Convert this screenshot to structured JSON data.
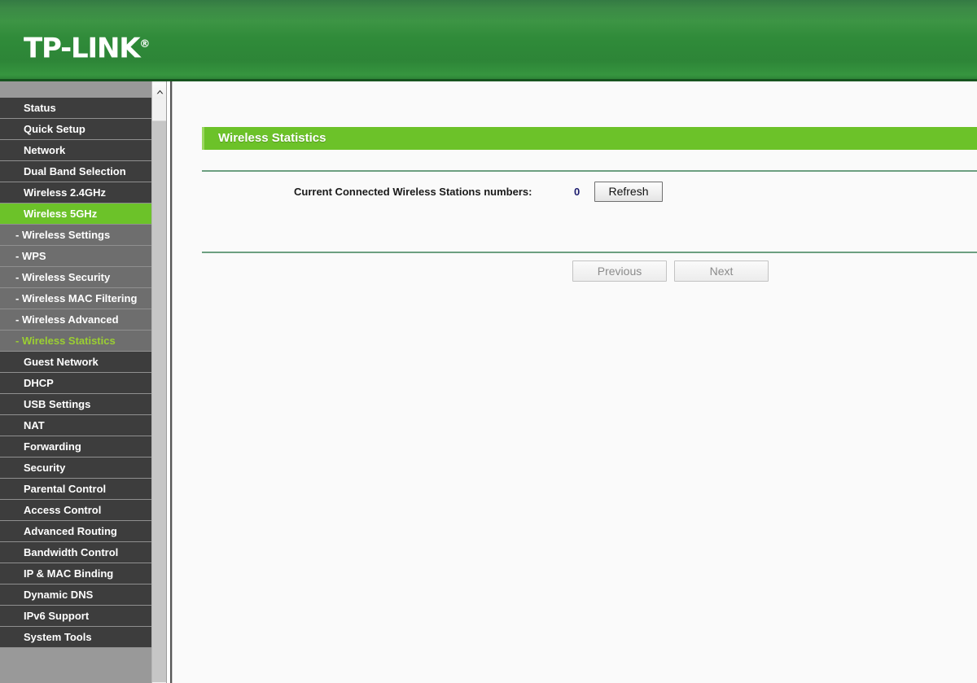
{
  "header": {
    "brand": "TP-LINK",
    "brand_mark": "®",
    "brand_color": "#2f8a39"
  },
  "sidebar": {
    "items": [
      {
        "label": "Status",
        "type": "top",
        "state": "normal"
      },
      {
        "label": "Quick Setup",
        "type": "top",
        "state": "normal"
      },
      {
        "label": "Network",
        "type": "top",
        "state": "normal"
      },
      {
        "label": "Dual Band Selection",
        "type": "top",
        "state": "normal"
      },
      {
        "label": "Wireless 2.4GHz",
        "type": "top",
        "state": "normal"
      },
      {
        "label": "Wireless 5GHz",
        "type": "top",
        "state": "active"
      },
      {
        "label": "- Wireless Settings",
        "type": "sub",
        "state": "normal"
      },
      {
        "label": "- WPS",
        "type": "sub",
        "state": "normal"
      },
      {
        "label": "- Wireless Security",
        "type": "sub",
        "state": "normal"
      },
      {
        "label": "- Wireless MAC Filtering",
        "type": "sub",
        "state": "normal"
      },
      {
        "label": "- Wireless Advanced",
        "type": "sub",
        "state": "normal"
      },
      {
        "label": "- Wireless Statistics",
        "type": "sub",
        "state": "selected"
      },
      {
        "label": "Guest Network",
        "type": "top",
        "state": "normal"
      },
      {
        "label": "DHCP",
        "type": "top",
        "state": "normal"
      },
      {
        "label": "USB Settings",
        "type": "top",
        "state": "normal"
      },
      {
        "label": "NAT",
        "type": "top",
        "state": "normal"
      },
      {
        "label": "Forwarding",
        "type": "top",
        "state": "normal"
      },
      {
        "label": "Security",
        "type": "top",
        "state": "normal"
      },
      {
        "label": "Parental Control",
        "type": "top",
        "state": "normal"
      },
      {
        "label": "Access Control",
        "type": "top",
        "state": "normal"
      },
      {
        "label": "Advanced Routing",
        "type": "top",
        "state": "normal"
      },
      {
        "label": "Bandwidth Control",
        "type": "top",
        "state": "normal"
      },
      {
        "label": "IP & MAC Binding",
        "type": "top",
        "state": "normal"
      },
      {
        "label": "Dynamic DNS",
        "type": "top",
        "state": "normal"
      },
      {
        "label": "IPv6 Support",
        "type": "top",
        "state": "normal"
      },
      {
        "label": "System Tools",
        "type": "top",
        "state": "normal"
      }
    ],
    "active_color": "#6cc229",
    "selected_text_color": "#9bcf32",
    "scrollbar": {
      "up_arrow_icon": "chevron-up-icon"
    }
  },
  "main": {
    "page_title": "Wireless Statistics",
    "stations": {
      "label": "Current Connected Wireless Stations numbers:",
      "value": "0",
      "refresh_label": "Refresh"
    },
    "pagination": {
      "previous_label": "Previous",
      "next_label": "Next"
    }
  }
}
